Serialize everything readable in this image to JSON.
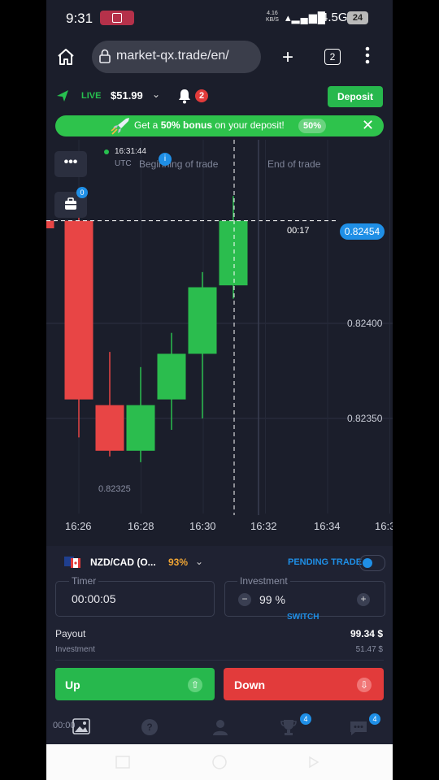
{
  "status_bar": {
    "time": "9:31",
    "net_speed_top": "4.16",
    "net_speed_bottom": "KB/S",
    "network": "4.5G",
    "battery": "24"
  },
  "browser": {
    "url": "market-qx.trade/en/",
    "tab_count": "2"
  },
  "header": {
    "mode": "LIVE",
    "balance": "$51.99",
    "notifications": "2",
    "deposit_label": "Deposit"
  },
  "promo": {
    "text_before": "Get a ",
    "bold_text": "50% bonus",
    "text_after": " on your deposit!",
    "badge": "50%"
  },
  "chart_overlay": {
    "clock": "16:31:44",
    "timezone": "UTC",
    "portfolio_count": "0",
    "begin_label": "Beginning of trade",
    "end_label": "End of trade",
    "countdown": "00:17",
    "current_price": "0.82454",
    "low_price": "0.82325",
    "info_icon": "i"
  },
  "chart_data": {
    "type": "candlestick",
    "y_tick_labels": [
      "0.82400",
      "0.82350"
    ],
    "x_tick_labels": [
      "16:26",
      "16:28",
      "16:30",
      "16:32",
      "16:34",
      "16:3"
    ],
    "ylim": [
      0.8231,
      0.82475
    ],
    "candles": [
      {
        "time": "16:25:20",
        "open": 0.82454,
        "close": 0.8245,
        "high": 0.82458,
        "low": 0.8244,
        "color": "red"
      },
      {
        "time": "16:26",
        "open": 0.82454,
        "close": 0.8236,
        "high": 0.82456,
        "low": 0.8234,
        "color": "red"
      },
      {
        "time": "16:27",
        "open": 0.82357,
        "close": 0.82333,
        "high": 0.82385,
        "low": 0.8233,
        "color": "red"
      },
      {
        "time": "16:28",
        "open": 0.82333,
        "close": 0.82357,
        "high": 0.82377,
        "low": 0.82327,
        "color": "green"
      },
      {
        "time": "16:29",
        "open": 0.8236,
        "close": 0.82384,
        "high": 0.82395,
        "low": 0.82344,
        "color": "green"
      },
      {
        "time": "16:30",
        "open": 0.82384,
        "close": 0.82419,
        "high": 0.82427,
        "low": 0.8235,
        "color": "green"
      },
      {
        "time": "16:31",
        "open": 0.8242,
        "close": 0.82454,
        "high": 0.82467,
        "low": 0.82413,
        "color": "green"
      }
    ],
    "current_price": 0.82454,
    "begin_marker_time": "16:31",
    "end_marker_time": "16:31:30",
    "grid": true
  },
  "trade_panel": {
    "asset": "NZD/CAD (O...",
    "payout_pct": "93%",
    "pending_label": "PENDING TRADE",
    "timer_label": "Timer",
    "timer_value": "00:00:05",
    "investment_label": "Investment",
    "investment_value": "99 %",
    "switch_label": "SWITCH",
    "minus": "−",
    "plus": "+",
    "payout_label": "Payout",
    "payout_value": "99.34 $",
    "investment_small_label": "Investment",
    "investment_small_value": "51.47 $",
    "up_label": "Up",
    "down_label": "Down",
    "up_arrow": "⇧",
    "down_arrow": "⇩"
  },
  "bottom_nav": {
    "time": "00:00",
    "help": "?",
    "trophy_badge": "4",
    "chat_badge": "4"
  },
  "colors": {
    "green": "#27b84d",
    "red": "#e23b3b",
    "blue": "#1f8fe6",
    "background": "#1b1e2b"
  }
}
